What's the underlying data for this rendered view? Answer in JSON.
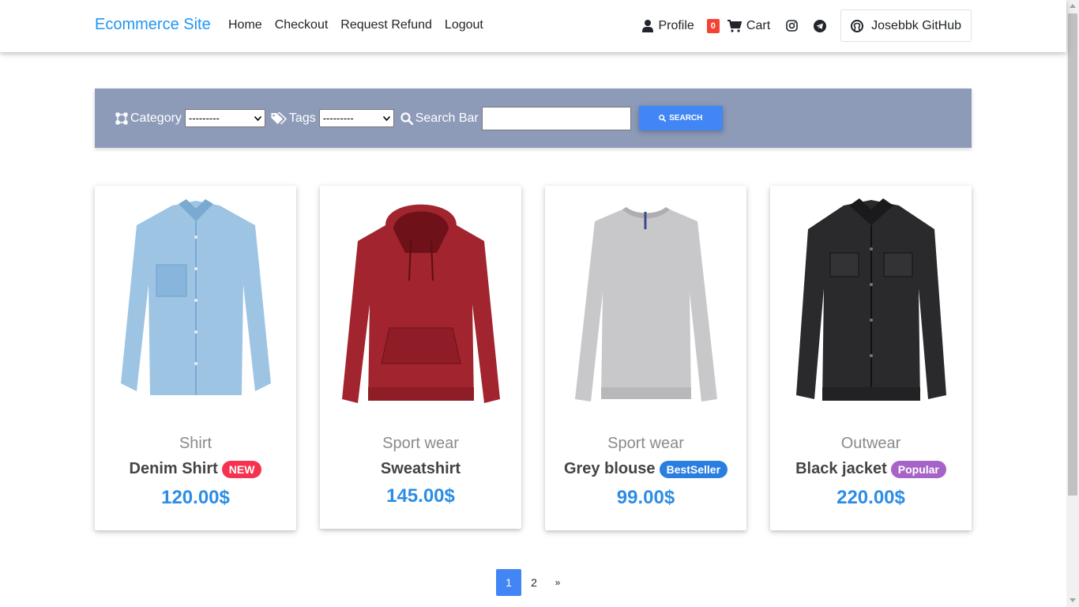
{
  "navbar": {
    "brand": "Ecommerce Site",
    "links": [
      "Home",
      "Checkout",
      "Request Refund",
      "Logout"
    ],
    "profile_label": "Profile",
    "cart_count": "0",
    "cart_label": "Cart",
    "github_label": "Josebbk GitHub",
    "brand_color": "#2196f3"
  },
  "filters": {
    "category_label": "Category",
    "category_value": "---------",
    "tags_label": "Tags",
    "tags_value": "---------",
    "search_label": "Search Bar",
    "search_value": "",
    "search_button": "SEARCH",
    "bar_color": "#8d9bb8"
  },
  "products": [
    {
      "category": "Shirt",
      "name": "Denim Shirt",
      "badge": "NEW",
      "badge_color": "#f5334f",
      "price": "120.00$",
      "image": "denim-shirt"
    },
    {
      "category": "Sport wear",
      "name": "Sweatshirt",
      "badge": "",
      "badge_color": "",
      "price": "145.00$",
      "image": "red-hoodie"
    },
    {
      "category": "Sport wear",
      "name": "Grey blouse",
      "badge": "BestSeller",
      "badge_color": "#2a7ee0",
      "price": "99.00$",
      "image": "grey-sweater"
    },
    {
      "category": "Outwear",
      "name": "Black jacket",
      "badge": "Popular",
      "badge_color": "#a764c8",
      "price": "220.00$",
      "image": "black-denim-jacket"
    }
  ],
  "pagination": {
    "pages": [
      "1",
      "2"
    ],
    "current": "1",
    "next": "»"
  }
}
